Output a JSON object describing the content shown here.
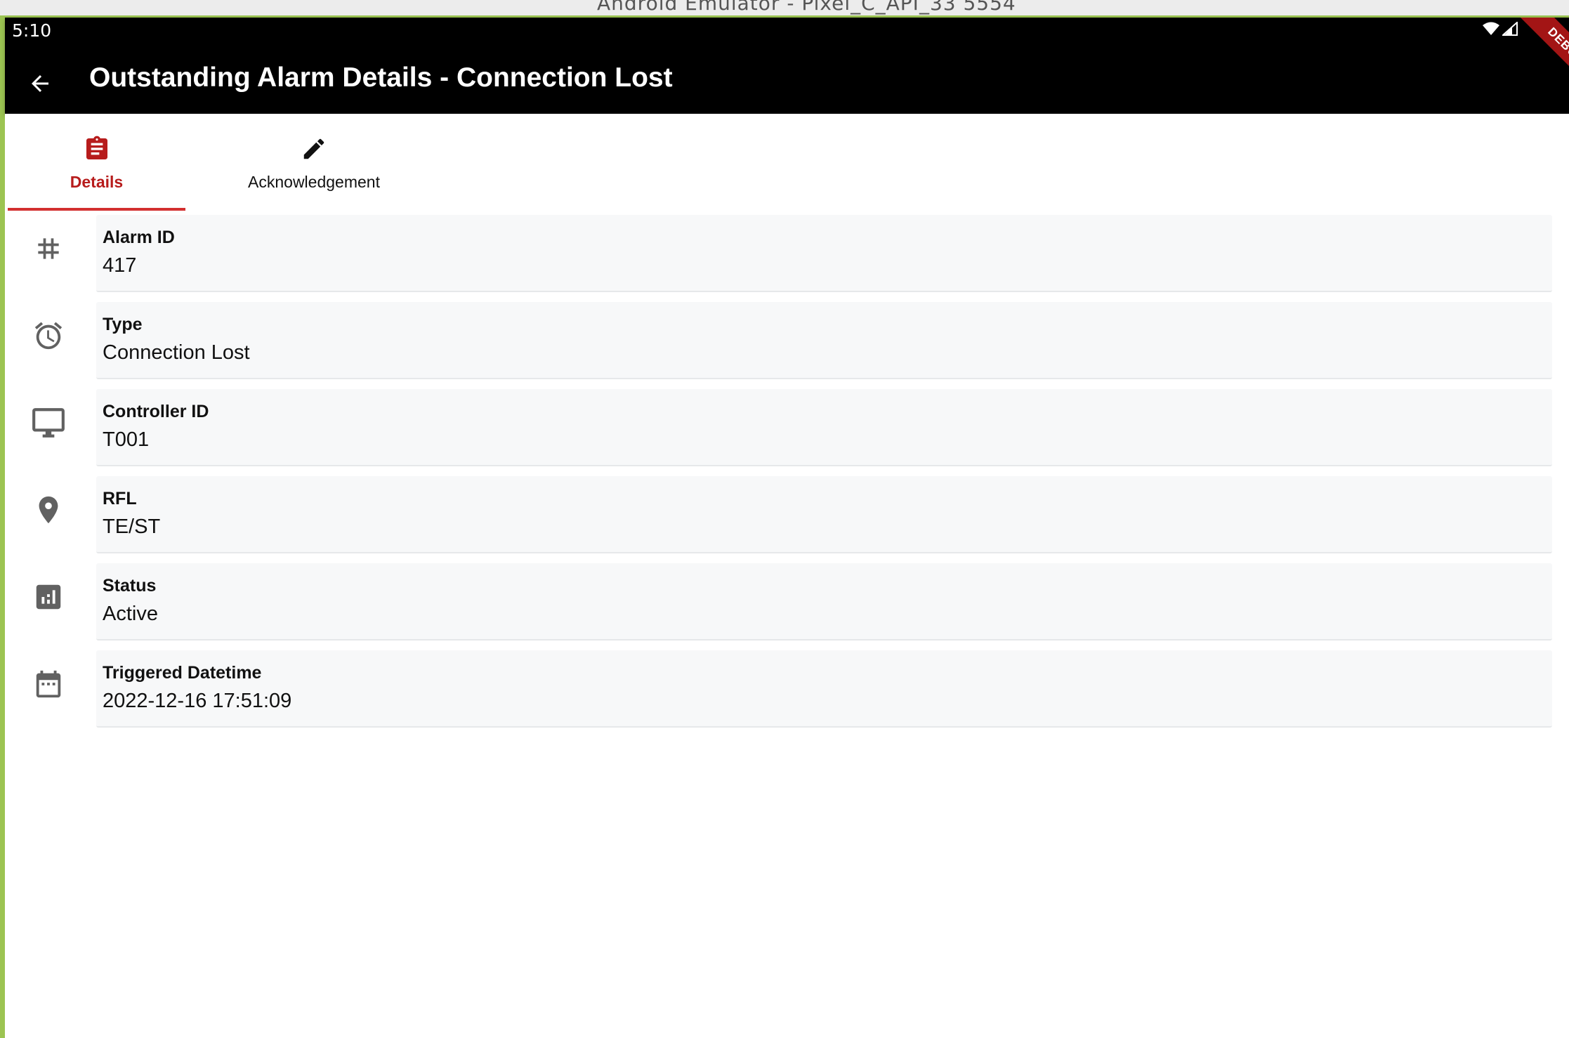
{
  "emulator": {
    "title": "Android Emulator - Pixel_C_API_33 5554"
  },
  "status_bar": {
    "time": "5:10",
    "icons": [
      "wifi-icon",
      "cell-signal-icon"
    ]
  },
  "app_bar": {
    "title": "Outstanding Alarm Details - Connection Lost",
    "back_icon": "arrow-back-icon",
    "debug_banner": "DEBUG"
  },
  "tabs": [
    {
      "label": "Details",
      "icon": "clipboard-icon",
      "selected": true
    },
    {
      "label": "Acknowledgement",
      "icon": "pencil-icon",
      "selected": false
    }
  ],
  "colors": {
    "accent": "#d32f2f",
    "selected_tab": "#b71c1c",
    "app_bar": "#000000",
    "card": "#f7f8f9",
    "icon_gray": "#616161"
  },
  "details": [
    {
      "label": "Alarm ID",
      "value": "417",
      "icon": "hash-icon"
    },
    {
      "label": "Type",
      "value": "Connection Lost",
      "icon": "alarm-clock-icon"
    },
    {
      "label": "Controller ID",
      "value": "T001",
      "icon": "monitor-icon"
    },
    {
      "label": "RFL",
      "value": "TE/ST",
      "icon": "location-pin-icon"
    },
    {
      "label": "Status",
      "value": "Active",
      "icon": "bar-chart-icon"
    },
    {
      "label": "Triggered Datetime",
      "value": "2022-12-16 17:51:09",
      "icon": "calendar-icon"
    }
  ]
}
